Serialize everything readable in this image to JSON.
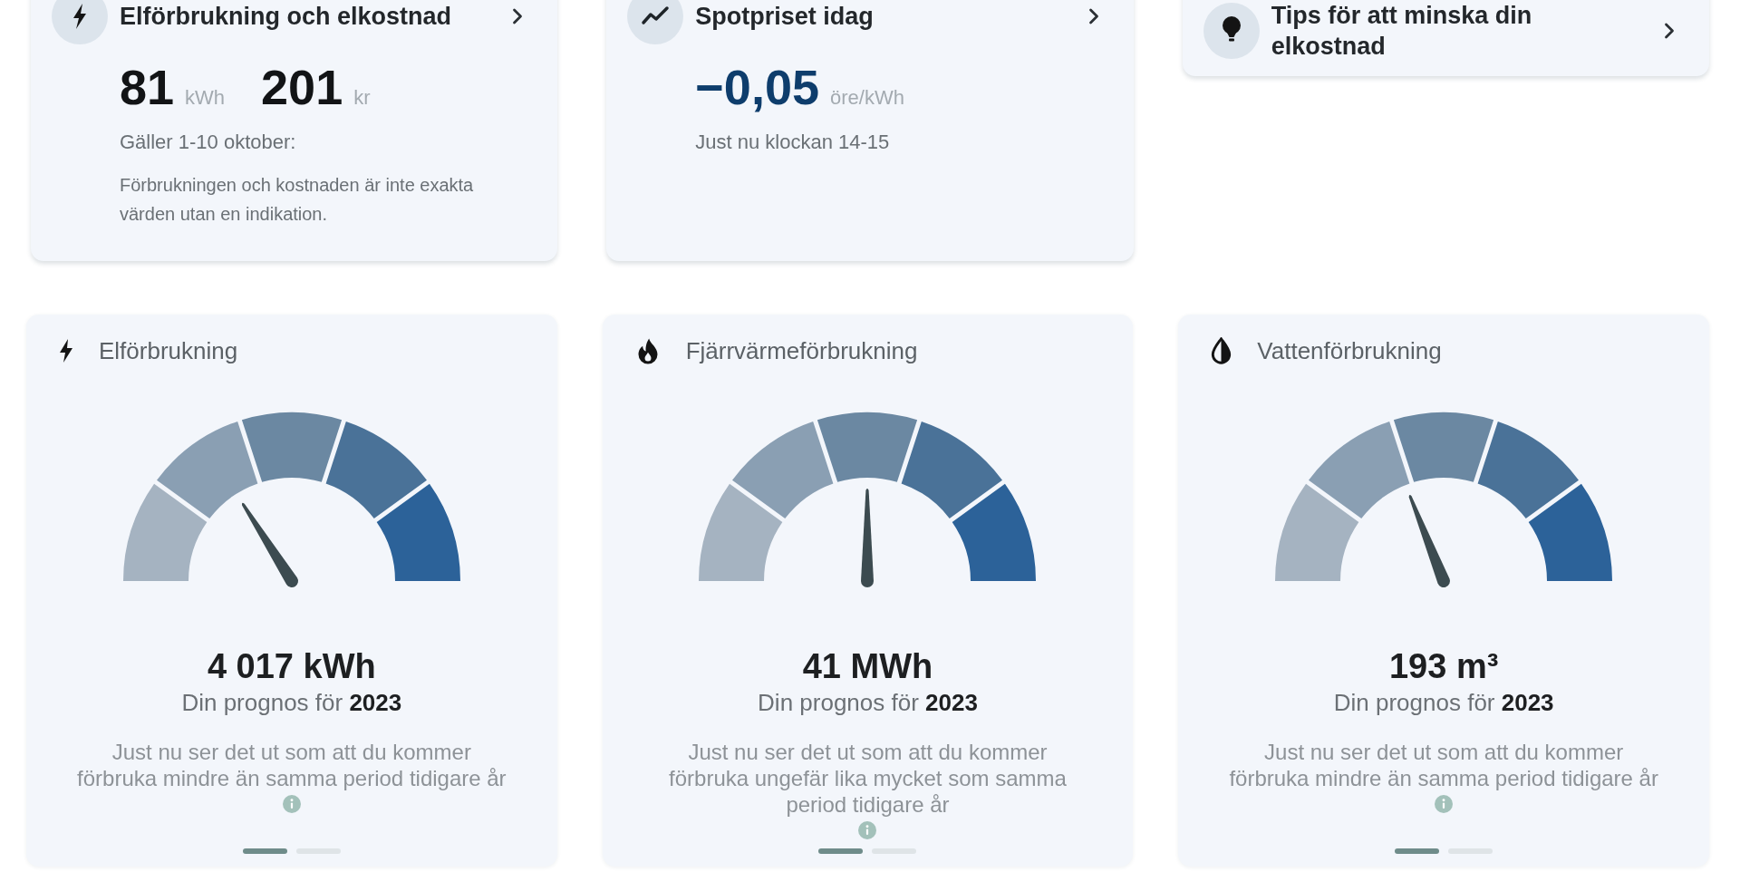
{
  "summary_cards": [
    {
      "kind": "consumption",
      "title": "Elförbrukning och elkostnad",
      "values": [
        {
          "value": "81",
          "unit": "kWh"
        },
        {
          "value": "201",
          "unit": "kr"
        }
      ],
      "period": "Gäller 1-10 oktober:",
      "note": "Förbrukningen och kostnaden är inte exakta värden utan en indikation."
    },
    {
      "kind": "price",
      "title": "Spotpriset idag",
      "values": [
        {
          "value": "−0,05",
          "unit": "öre/kWh"
        }
      ],
      "period": "Just nu klockan 14-15"
    },
    {
      "kind": "tips",
      "title": "Tips för att minska din elkostnad"
    }
  ],
  "gauges": [
    {
      "kind": "electricity",
      "title": "Elförbrukning",
      "level": 0.32,
      "value": "4 017 kWh",
      "forecast": "Din prognos för **2023**",
      "description": "Just nu ser det ut som att du kommer förbruka mindre än samma period tidigare år",
      "pages": [
        {
          "selected": true
        },
        {
          "selected": false
        }
      ]
    },
    {
      "kind": "heating",
      "title": "Fjärrvärmeförbrukning",
      "level": 0.5,
      "value": "41 MWh",
      "forecast": "Din prognos för **2023**",
      "description": "Just nu ser det ut som att du kommer förbruka ungefär lika mycket som samma period tidigare år",
      "pages": [
        {
          "selected": true
        },
        {
          "selected": false
        }
      ]
    },
    {
      "kind": "water",
      "title": "Vattenförbrukning",
      "level": 0.38,
      "value": "193 m³",
      "forecast": "Din prognos för **2023**",
      "description": "Just nu ser det ut som att du kommer förbruka mindre än samma period tidigare år",
      "pages": [
        {
          "selected": true
        },
        {
          "selected": false
        }
      ]
    }
  ]
}
